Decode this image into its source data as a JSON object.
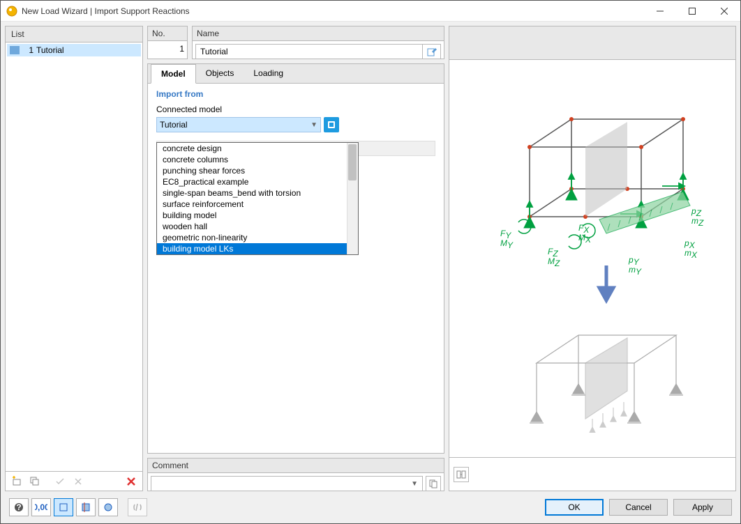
{
  "window": {
    "title": "New Load Wizard | Import Support Reactions"
  },
  "list": {
    "header": "List",
    "items": [
      {
        "num": "1",
        "label": "Tutorial",
        "selected": true
      }
    ]
  },
  "fields": {
    "no_header": "No.",
    "no_value": "1",
    "name_header": "Name",
    "name_value": "Tutorial"
  },
  "tabs": {
    "items": [
      "Model",
      "Objects",
      "Loading"
    ],
    "active": "Model"
  },
  "import": {
    "group_title": "Import from",
    "connected_label": "Connected model",
    "selected": "Tutorial",
    "options": [
      "concrete design",
      "concrete columns",
      "punching shear forces",
      "EC8_practical example",
      "single-span beams_bend with torsion",
      "surface reinforcement",
      "building model",
      "wooden hall",
      "geometric non-linearity",
      "building model LKs"
    ],
    "highlighted_index": 9
  },
  "comment": {
    "header": "Comment",
    "value": ""
  },
  "buttons": {
    "ok": "OK",
    "cancel": "Cancel",
    "apply": "Apply"
  },
  "diagram_labels": {
    "Fy": "F",
    "Fy2": "Y",
    "My": "M",
    "My2": "Y",
    "Fx": "F",
    "Fx2": "X",
    "Mx": "M",
    "Mx2": "X",
    "Fz": "F",
    "Fz2": "Z",
    "Mz": "M",
    "Mz2": "Z",
    "pz": "p",
    "pz2": "Z",
    "mz": "m",
    "mz2": "Z",
    "px": "p",
    "px2": "X",
    "mx": "m",
    "mx2": "X",
    "py": "p",
    "py2": "Y",
    "my": "m",
    "my2": "Y"
  }
}
